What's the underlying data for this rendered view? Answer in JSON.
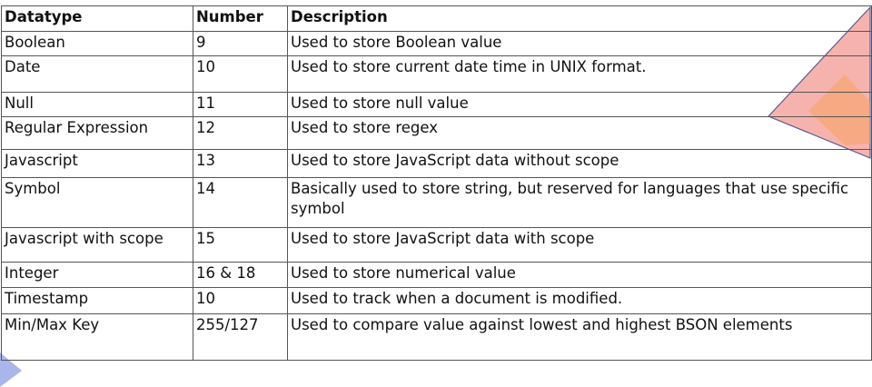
{
  "table": {
    "headers": [
      "Datatype",
      "Number",
      "Description"
    ],
    "rows": [
      [
        "Boolean",
        "9",
        "Used to store Boolean value"
      ],
      [
        "Date",
        "10",
        "Used to store current date time in UNIX format."
      ],
      [
        "Null",
        "11",
        "Used to store null value"
      ],
      [
        "Regular Expression",
        "12",
        "Used to store regex"
      ],
      [
        "Javascript",
        "13",
        "Used to store JavaScript data without scope"
      ],
      [
        "Symbol",
        "14",
        "Basically used to store string, but reserved for languages that use specific symbol"
      ],
      [
        "Javascript with scope",
        "15",
        "Used to store JavaScript data with scope"
      ],
      [
        "Integer",
        "16 & 18",
        "Used to store numerical value"
      ],
      [
        "Timestamp",
        "10",
        "Used to track when a document is modified."
      ],
      [
        "Min/Max Key",
        "255/127",
        "Used to compare value against lowest and highest BSON elements"
      ]
    ]
  },
  "colors": {
    "border": "#555555",
    "triangle_fill": "#f4a09a",
    "triangle_accent": "#f7a060",
    "triangle_stroke": "#5a5a90",
    "corner_accent": "#9aa9e6"
  }
}
